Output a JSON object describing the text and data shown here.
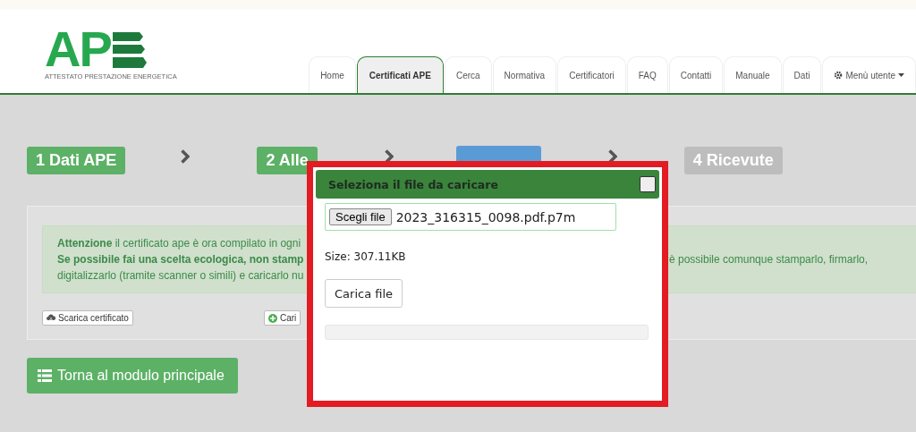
{
  "logo": {
    "letters": "AP",
    "tagline": "ATTESTATO PRESTAZIONE ENERGETICA"
  },
  "tabs": [
    {
      "label": "Home",
      "selected": false
    },
    {
      "label": "Certificati APE",
      "selected": true
    },
    {
      "label": "Cerca",
      "selected": false
    },
    {
      "label": "Normativa",
      "selected": false
    },
    {
      "label": "Certificatori",
      "selected": false
    },
    {
      "label": "FAQ",
      "selected": false
    },
    {
      "label": "Contatti",
      "selected": false
    },
    {
      "label": "Manuale",
      "selected": false
    },
    {
      "label": "Dati",
      "selected": false
    },
    {
      "label": "Menù utente",
      "selected": false,
      "kind": "menu"
    }
  ],
  "steps": [
    {
      "label": "1 Dati APE",
      "kind": "done"
    },
    {
      "label": "2 Alle",
      "kind": "done"
    },
    {
      "kind": "active"
    },
    {
      "label": "4 Ricevute",
      "kind": "pending"
    }
  ],
  "alert": {
    "left_lines": [
      "**Attenzione** il certificato ape è ora compilato in ogni",
      "**Se possibile fai una scelta ecologica, non stamp**",
      "digitalizzarlo (tramite scanner o simili) e caricarlo nu"
    ],
    "right_lines": [
      "è possibile comunque stamparlo, firmarlo,"
    ]
  },
  "actions": [
    {
      "label": "Scarica certificato",
      "kind": "download"
    },
    {
      "label": "Cari",
      "kind": "add"
    }
  ],
  "back_button": "Torna al modulo principale",
  "modal": {
    "title": "Seleziona il file da caricare",
    "choose_button": "Scegli file",
    "file_name": "2023_316315_0098.pdf.p7m",
    "size": "Size: 307.11KB",
    "upload_button": "Carica file",
    "progress": {
      "level": 0
    }
  }
}
